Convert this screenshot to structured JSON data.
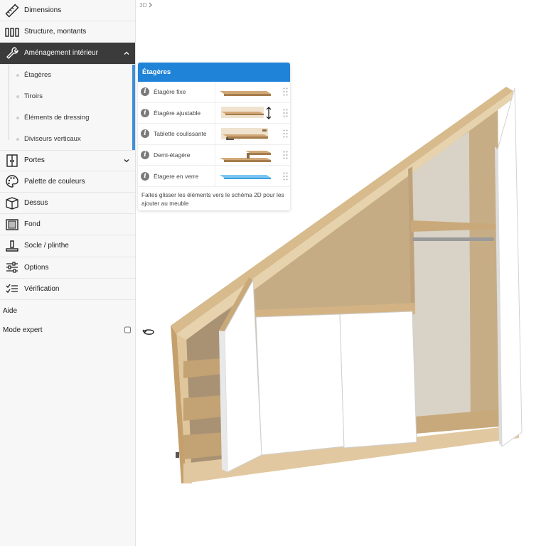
{
  "breadcrumb": {
    "label": "3D"
  },
  "sidebar": {
    "items": [
      {
        "label": "Dimensions",
        "icon": "ruler-icon"
      },
      {
        "label": "Structure, montants",
        "icon": "columns-icon"
      },
      {
        "label": "Aménagement intérieur",
        "icon": "wrench-icon",
        "active": true,
        "expanded": true
      },
      {
        "label": "Portes",
        "icon": "door-icon",
        "expanded": false
      },
      {
        "label": "Palette de couleurs",
        "icon": "palette-icon"
      },
      {
        "label": "Dessus",
        "icon": "box-top-icon"
      },
      {
        "label": "Fond",
        "icon": "back-panel-icon"
      },
      {
        "label": "Socle / plinthe",
        "icon": "plinth-icon"
      },
      {
        "label": "Options",
        "icon": "sliders-icon"
      },
      {
        "label": "Vérification",
        "icon": "checklist-icon"
      }
    ],
    "subitems": [
      "Étagères",
      "Tiroirs",
      "Éléments de dressing",
      "Diviseurs verticaux"
    ],
    "help_label": "Aide",
    "expert_label": "Mode expert",
    "expert_checked": false
  },
  "panel": {
    "title": "Étagères",
    "items": [
      {
        "label": "Étagère fixe",
        "icon": "fixed-shelf-icon"
      },
      {
        "label": "Étagère ajustable",
        "icon": "adjustable-shelf-icon"
      },
      {
        "label": "Tablette coulissante",
        "icon": "sliding-shelf-icon"
      },
      {
        "label": "Demi-étagère",
        "icon": "half-shelf-icon"
      },
      {
        "label": "Étagere en verre",
        "icon": "glass-shelf-icon"
      }
    ],
    "hint": "Faites glisser les éléments vers le schéma 2D pour les ajouter au meuble"
  },
  "colors": {
    "accent": "#1f84d8",
    "active_bg": "#3b3b3b",
    "wood": "#c9a679",
    "glass": "#5ab4ee"
  }
}
